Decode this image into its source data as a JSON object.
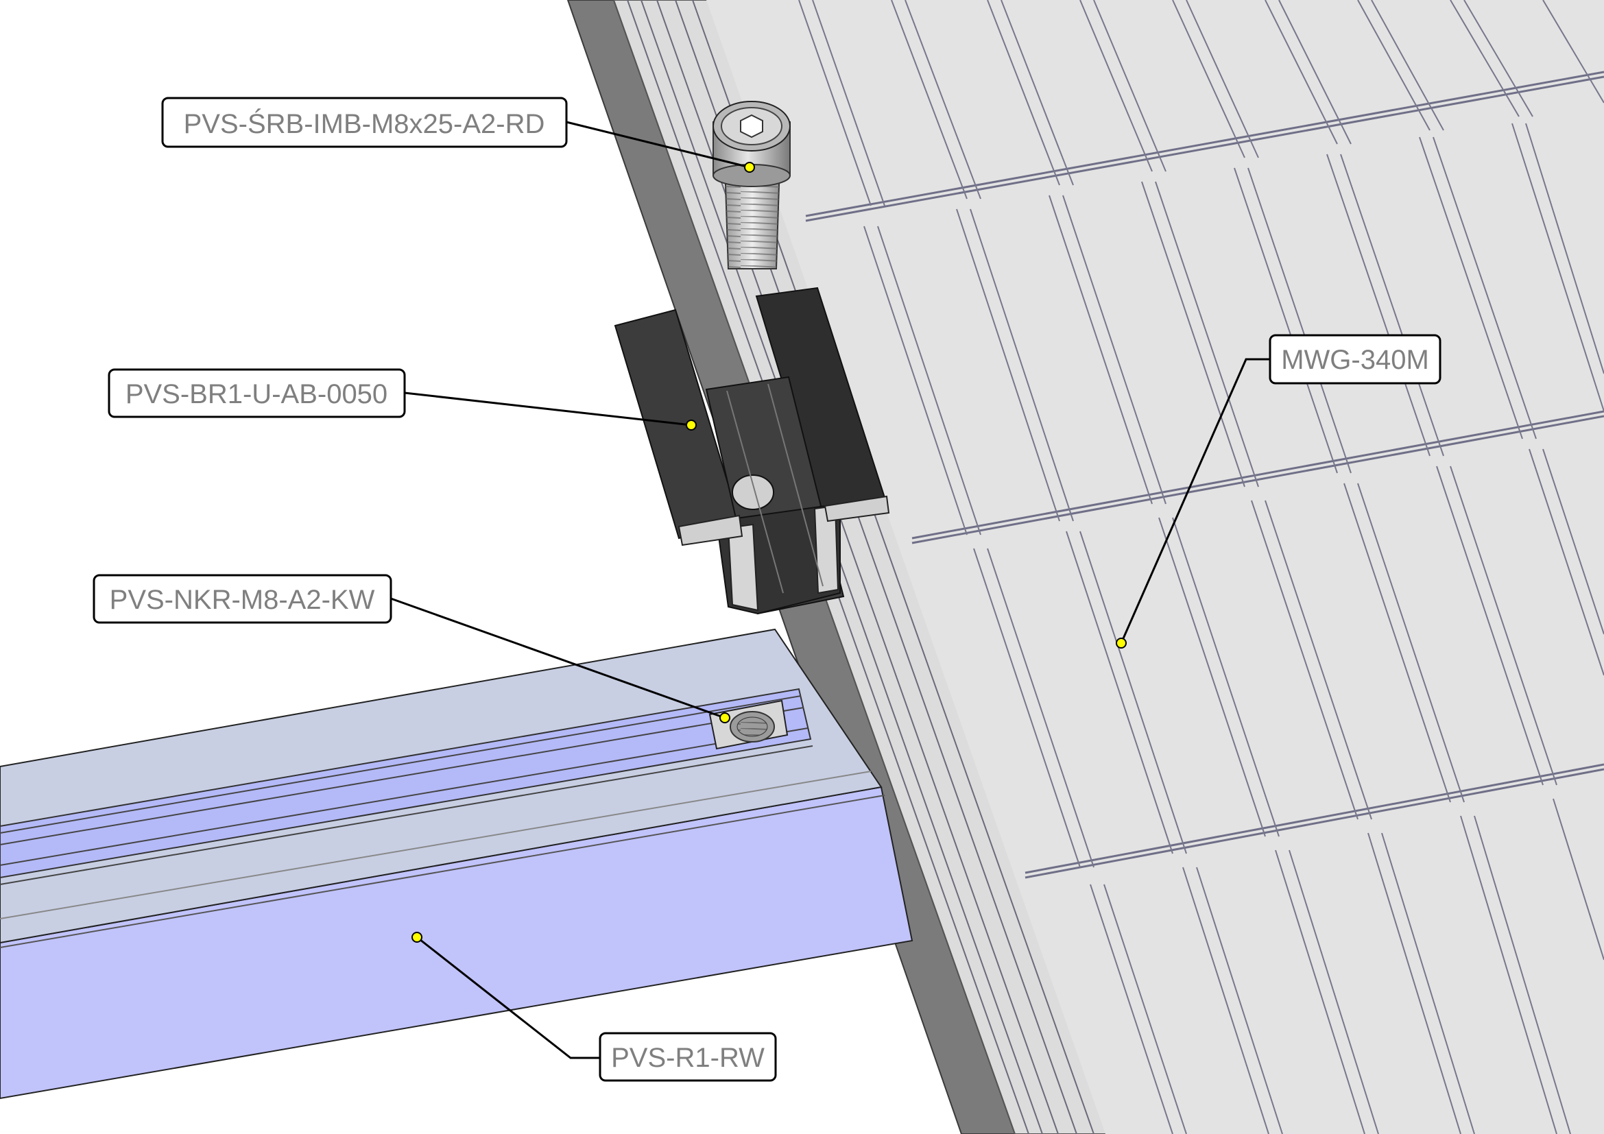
{
  "callouts": {
    "bolt": "PVS-ŚRB-IMB-M8x25-A2-RD",
    "clamp": "PVS-BR1-U-AB-0050",
    "nut": "PVS-NKR-M8-A2-KW",
    "rail": "PVS-R1-RW",
    "module": "MWG-340M"
  },
  "colors": {
    "background": "#ffffff",
    "module_surface": "#e3e3e3",
    "module_frame": "#7b7b7b",
    "module_cell_lines": "#6f6f88",
    "clamp": "#3a3a3a",
    "rail_top": "#c8cfe3",
    "rail_side": "#c1c3fb",
    "bolt": "#c9c9c9",
    "callout_dot": "#ffff00",
    "callout_text": "#7f7f7f"
  }
}
